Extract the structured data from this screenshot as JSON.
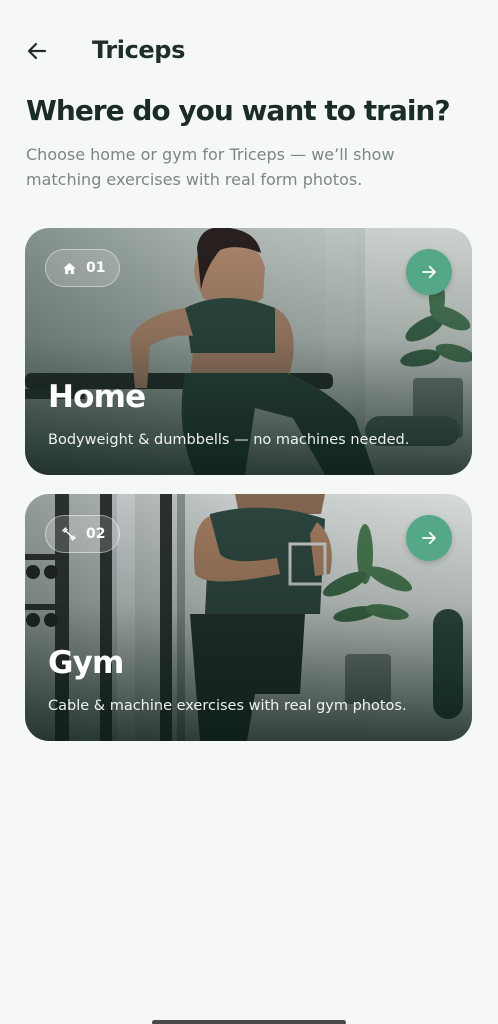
{
  "header": {
    "title": "Triceps",
    "back_icon": "arrow-left-icon"
  },
  "main": {
    "headline": "Where do you want to train?",
    "subtitle": "Choose home or gym for Triceps — we’ll show matching exercises with real form photos."
  },
  "options": [
    {
      "badge_icon": "home-icon",
      "badge_number": "01",
      "title": "Home",
      "description": "Bodyweight & dumbbells — no machines needed.",
      "action_icon": "arrow-right-icon"
    },
    {
      "badge_icon": "dumbbell-icon",
      "badge_number": "02",
      "title": "Gym",
      "description": "Cable & machine exercises with real gym photos.",
      "action_icon": "arrow-right-icon"
    }
  ],
  "colors": {
    "background": "#f5f8f6",
    "text_primary": "#1b2c27",
    "text_secondary": "#7b8783",
    "accent": "#55a887"
  }
}
